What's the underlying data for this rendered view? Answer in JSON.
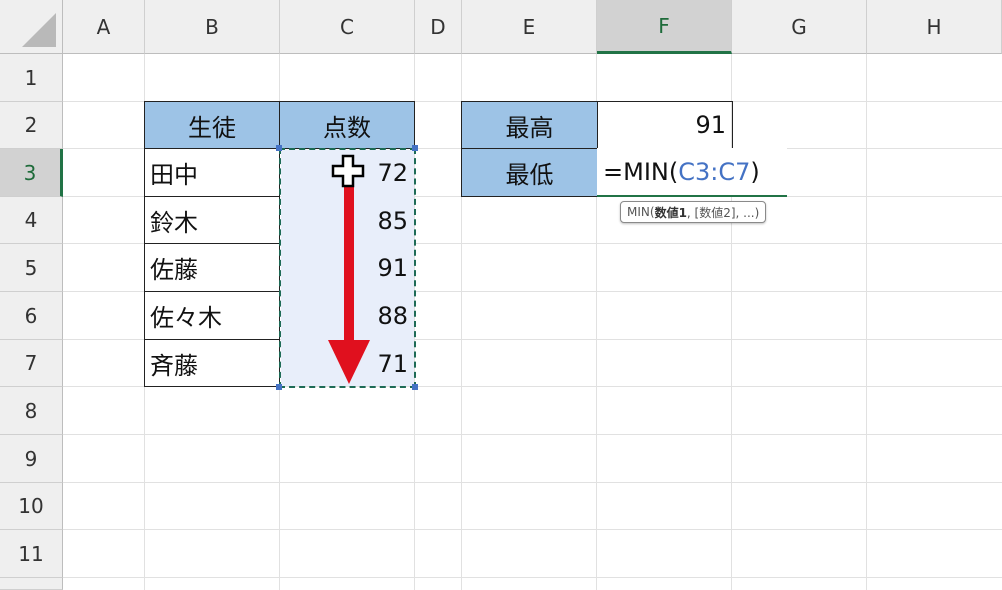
{
  "columns": [
    "A",
    "B",
    "C",
    "D",
    "E",
    "F",
    "G",
    "H"
  ],
  "rows": [
    "1",
    "2",
    "3",
    "4",
    "5",
    "6",
    "7",
    "8",
    "9",
    "10",
    "11"
  ],
  "active_cell": {
    "column": "F",
    "row": "3"
  },
  "student_table": {
    "header_student": "生徒",
    "header_score": "点数",
    "rows": [
      {
        "name": "田中",
        "score": "72"
      },
      {
        "name": "鈴木",
        "score": "85"
      },
      {
        "name": "佐藤",
        "score": "91"
      },
      {
        "name": "佐々木",
        "score": "88"
      },
      {
        "name": "斉藤",
        "score": "71"
      }
    ]
  },
  "summary": {
    "max_label": "最高",
    "max_value": "91",
    "min_label": "最低",
    "formula_prefix": "=MIN(",
    "formula_ref": "C3:C7",
    "formula_suffix": ")"
  },
  "tooltip": {
    "fn": "MIN(",
    "arg1": "数値1",
    "rest": ", [数値2], ...)"
  },
  "colors": {
    "header_fill": "#9dc3e6",
    "reference": "#4472c4",
    "marquee": "#1e6b56",
    "arrow": "#e0101e",
    "active": "#217346"
  },
  "icons": [
    "select-all-triangle-icon",
    "cross-cursor-icon",
    "drag-down-arrow-icon"
  ]
}
